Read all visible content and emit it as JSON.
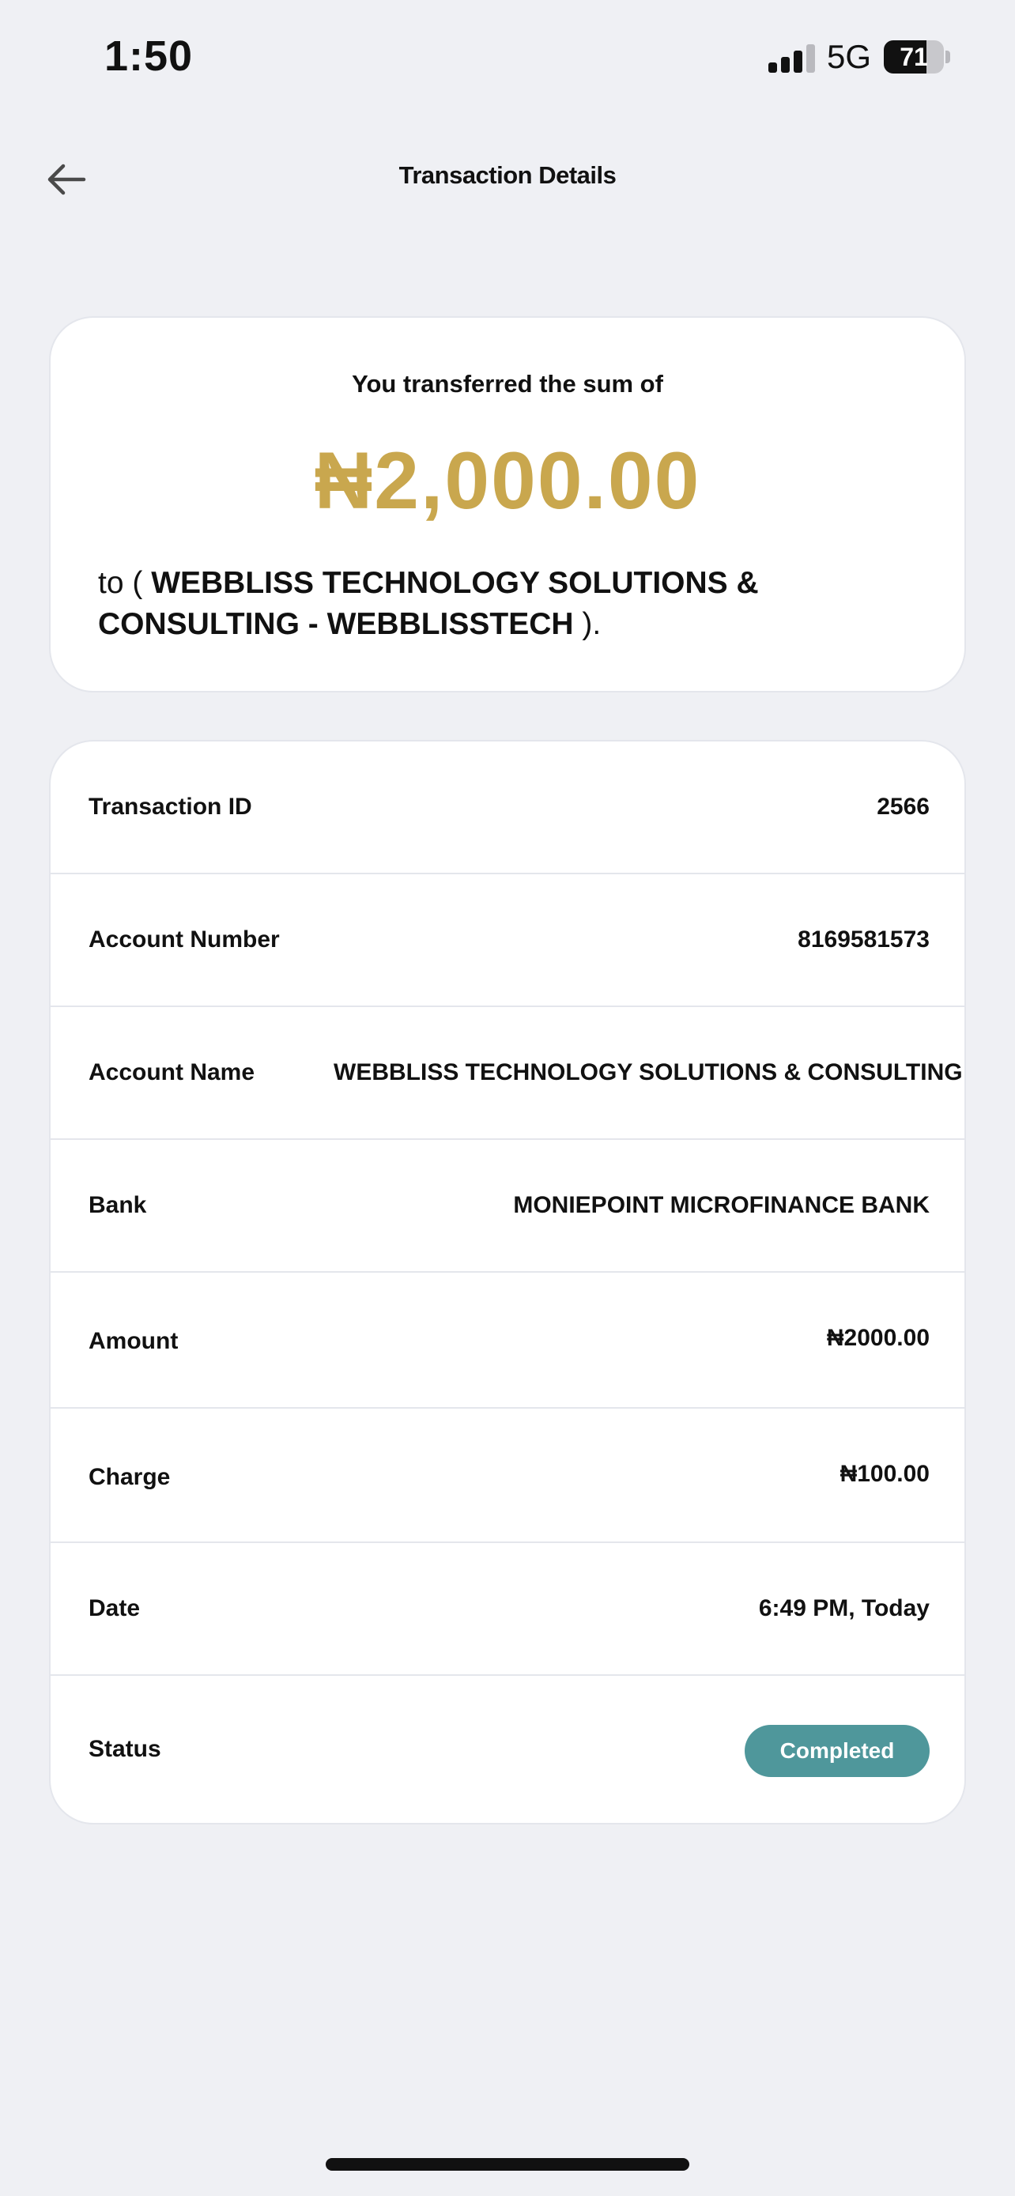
{
  "status_bar": {
    "time": "1:50",
    "network": "5G",
    "battery": "71",
    "battery_level_percent": 71
  },
  "header": {
    "title": "Transaction Details",
    "back_icon": "arrow-left-icon"
  },
  "summary": {
    "caption": "You transferred the sum of",
    "amount": "₦2,000.00",
    "to_prefix": "to ( ",
    "recipient": "WEBBLISS TECHNOLOGY SOLUTIONS & CONSULTING - WEBBLISSTECH",
    "to_suffix": " )."
  },
  "details": {
    "transaction_id": {
      "label": "Transaction ID",
      "value": "2566"
    },
    "account_number": {
      "label": "Account Number",
      "value": "8169581573"
    },
    "account_name": {
      "label": "Account Name",
      "value": "WEBBLISS TECHNOLOGY SOLUTIONS & CONSULTING - WEBBLISSTECH"
    },
    "bank": {
      "label": "Bank",
      "value": "MONIEPOINT MICROFINANCE BANK"
    },
    "amount": {
      "label": "Amount",
      "value": "₦2000.00"
    },
    "charge": {
      "label": "Charge",
      "value": "₦100.00"
    },
    "date": {
      "label": "Date",
      "value": "6:49 PM, Today"
    },
    "status": {
      "label": "Status",
      "value": "Completed"
    }
  },
  "colors": {
    "background": "#eff0f4",
    "accent_gold": "#c9a74e",
    "status_completed": "#4f979b"
  }
}
